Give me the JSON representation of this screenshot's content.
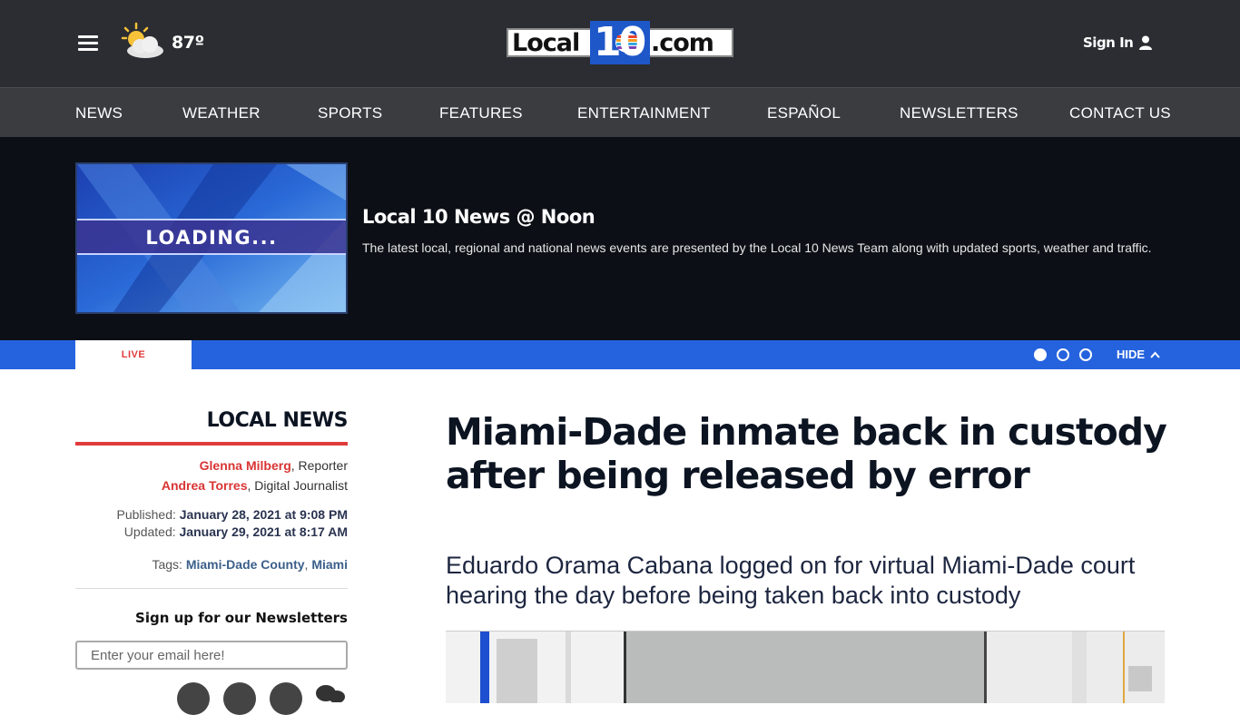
{
  "header": {
    "temperature": "87º",
    "logo": {
      "left": "Local",
      "ten": "10",
      "right": ".com"
    },
    "sign_in": "Sign In"
  },
  "nav": {
    "items": [
      "NEWS",
      "WEATHER",
      "SPORTS",
      "FEATURES",
      "ENTERTAINMENT",
      "ESPAÑOL",
      "NEWSLETTERS",
      "CONTACT US"
    ]
  },
  "live": {
    "thumbnail_text": "LOADING...",
    "title": "Local 10 News @ Noon",
    "description": "The latest local, regional and national news events are presented by the Local 10 News Team along with updated sports, weather and traffic.",
    "tab_label": "LIVE",
    "hide_label": "HIDE",
    "carousel_active_index": 0
  },
  "sidebar": {
    "section": "LOCAL NEWS",
    "authors": [
      {
        "name": "Glenna Milberg",
        "role": ", Reporter"
      },
      {
        "name": "Andrea Torres",
        "role": ", Digital Journalist"
      }
    ],
    "published_label": "Published: ",
    "published": "January 28, 2021 at 9:08 PM",
    "updated_label": "Updated: ",
    "updated": "January 29, 2021 at 8:17 AM",
    "tags_label": "Tags: ",
    "tags": [
      "Miami-Dade County",
      "Miami"
    ],
    "newsletter_title": "Sign up for our Newsletters",
    "email_placeholder": "Enter your email here!"
  },
  "article": {
    "headline": "Miami-Dade inmate back in custody after being released by error",
    "subhead": "Eduardo Orama Cabana logged on for virtual Miami-Dade court hearing the day before being taken back into custody"
  },
  "colors": {
    "header_bg": "#2b2d32",
    "nav_bg": "#3a3c40",
    "live_bg": "#0c1016",
    "accent_blue": "#2563de",
    "accent_red": "#e03b3b"
  }
}
